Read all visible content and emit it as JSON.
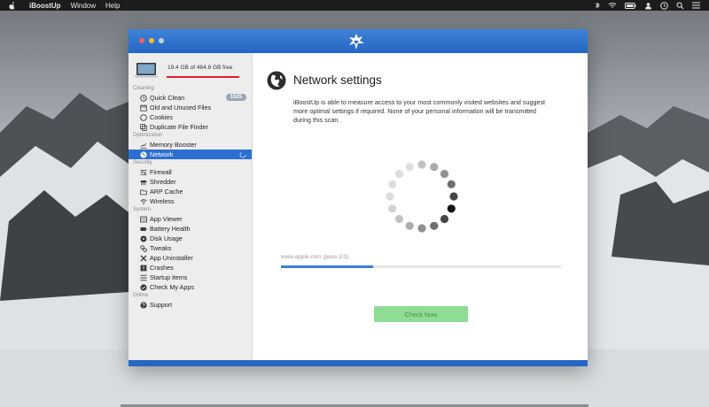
{
  "menubar": {
    "app": "iBoostUp",
    "items": [
      "Window",
      "Help"
    ]
  },
  "disk": {
    "usage_text": "19.4 GB of 464.8 GB free",
    "used_fraction": 1.0
  },
  "sidebar": {
    "sections": [
      {
        "title": "Cleaning",
        "items": [
          {
            "label": "Quick Clean",
            "icon": "clock-icon",
            "badge": "1525"
          },
          {
            "label": "Old and Unused Files",
            "icon": "calendar-icon"
          },
          {
            "label": "Cookies",
            "icon": "cookie-icon"
          },
          {
            "label": "Duplicate File Finder",
            "icon": "duplicate-icon"
          }
        ]
      },
      {
        "title": "Optimization",
        "items": [
          {
            "label": "Memory Booster",
            "icon": "chart-icon"
          },
          {
            "label": "Network",
            "icon": "globe-icon",
            "active": true
          }
        ]
      },
      {
        "title": "Security",
        "items": [
          {
            "label": "Firewall",
            "icon": "firewall-icon"
          },
          {
            "label": "Shredder",
            "icon": "shredder-icon"
          },
          {
            "label": "ARP Cache",
            "icon": "folder-icon"
          },
          {
            "label": "Wireless",
            "icon": "wifi-icon"
          }
        ]
      },
      {
        "title": "System",
        "items": [
          {
            "label": "App Viewer",
            "icon": "list-icon"
          },
          {
            "label": "Battery Health",
            "icon": "battery-icon"
          },
          {
            "label": "Disk Usage",
            "icon": "disk-icon"
          },
          {
            "label": "Tweaks",
            "icon": "gears-icon"
          },
          {
            "label": "App Uninstaller",
            "icon": "x-icon"
          },
          {
            "label": "Crashes",
            "icon": "crash-icon"
          },
          {
            "label": "Startup items",
            "icon": "startup-icon"
          },
          {
            "label": "Check My Apps",
            "icon": "check-icon"
          }
        ]
      },
      {
        "title": "Online",
        "items": [
          {
            "label": "Support",
            "icon": "question-icon"
          }
        ]
      }
    ]
  },
  "main": {
    "title": "Network settings",
    "description": "iBoostUp is able to measure access to your most commonly visited websites and suggest more optimal settings if required.  None of your personal information will be transmitted during this scan.",
    "progress_text": "www.apple.com (pass 2/3)",
    "progress_fraction": 0.33,
    "button_label": "Check Now"
  },
  "colors": {
    "accent": "#2467c4",
    "active_item": "#2d6fd0",
    "button": "#8fdc94",
    "disk_bar": "#e0202a"
  }
}
